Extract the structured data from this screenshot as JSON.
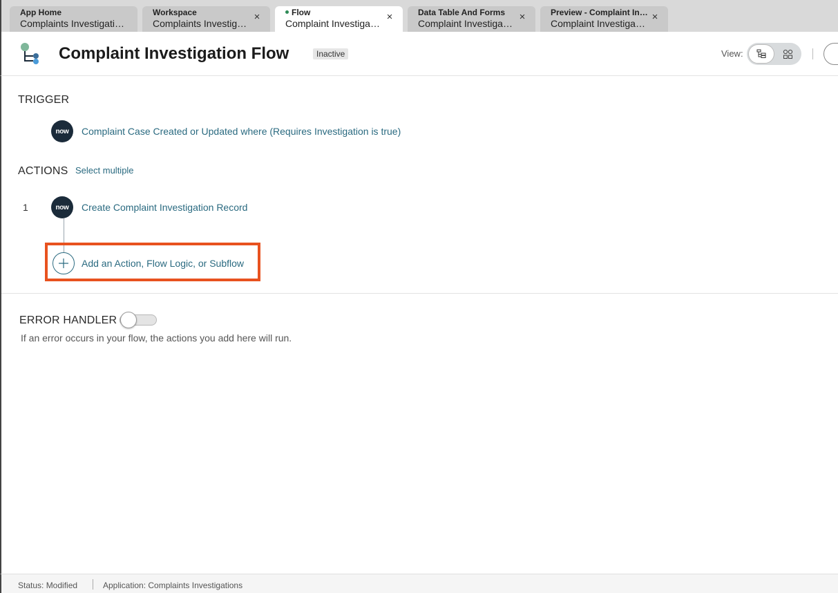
{
  "tabs": [
    {
      "title": "App Home",
      "subtitle": "Complaints Investigati…",
      "closable": false,
      "active": false
    },
    {
      "title": "Workspace",
      "subtitle": "Complaints Investig…",
      "closable": true,
      "active": false
    },
    {
      "title": "Flow",
      "subtitle": "Complaint Investiga…",
      "closable": true,
      "active": true,
      "modified_dot": true
    },
    {
      "title": "Data Table And Forms",
      "subtitle": "Complaint Investiga…",
      "closable": true,
      "active": false
    },
    {
      "title": "Preview - Complaint In…",
      "subtitle": "Complaint Investiga…",
      "closable": true,
      "active": false
    }
  ],
  "icons": {
    "tab_close": "×",
    "flow_icon": "flow-tree-icon",
    "tree_view": "tree-view-icon",
    "diagram_view": "diagram-view-icon",
    "add": "plus-icon",
    "now_logo": "now"
  },
  "header": {
    "title": "Complaint Investigation Flow",
    "status_badge": "Inactive",
    "view_label": "View:",
    "active_view": "tree"
  },
  "trigger": {
    "heading": "TRIGGER",
    "logo_text": "now",
    "label": "Complaint Case Created or Updated where (Requires Investigation is true)"
  },
  "actions": {
    "heading": "ACTIONS",
    "select_multiple": "Select multiple",
    "items": [
      {
        "number": "1",
        "logo_text": "now",
        "label": "Create Complaint Investigation Record"
      }
    ],
    "add_label": "Add an Action, Flow Logic, or Subflow"
  },
  "error_handler": {
    "heading": "ERROR HANDLER",
    "enabled": false,
    "helper": "If an error occurs in your flow, the actions you add here will run."
  },
  "statusbar": {
    "status": "Status: Modified",
    "application": "Application: Complaints Investigations"
  },
  "colors": {
    "link": "#2a6a80",
    "highlight": "#e8521f",
    "now_badge": "#1b2b3a",
    "modified_dot": "#2e8b57"
  }
}
